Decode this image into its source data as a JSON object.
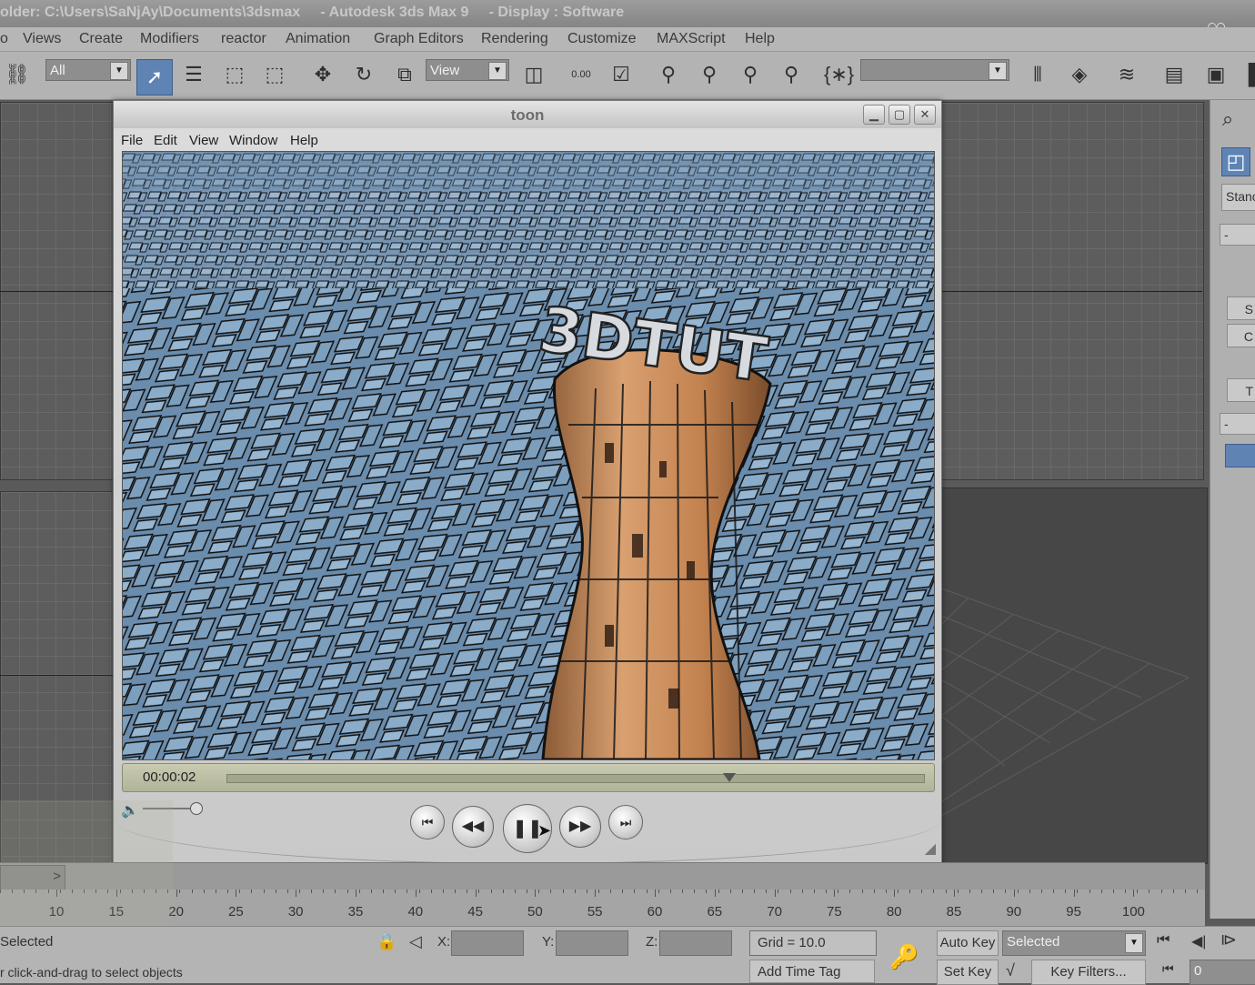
{
  "window": {
    "title": "older: C:\\Users\\SaNjAy\\Documents\\3dsmax     - Autodesk 3ds Max 9     - Display : Software"
  },
  "menu": [
    "o",
    "Views",
    "Create",
    "Modifiers",
    "reactor",
    "Animation",
    "Graph Editors",
    "Rendering",
    "Customize",
    "MAXScript",
    "Help"
  ],
  "toolbar": {
    "filter_value": "All",
    "refcoord_value": "View",
    "spinner_snap": "0.00",
    "selection_set_value": ""
  },
  "command_panel": {
    "dropdown_label": "Stanc",
    "rollout_minus": "-",
    "letters": [
      "S",
      "C",
      "T"
    ]
  },
  "toon_window": {
    "title": "toon",
    "menu": [
      "File",
      "Edit",
      "View",
      "Window",
      "Help"
    ],
    "render_text": "3DTUT",
    "timecode": "00:00:02",
    "playback_progress": 0.72
  },
  "timeline": {
    "ticks": [
      "10",
      "15",
      "20",
      "25",
      "30",
      "35",
      "40",
      "45",
      "50",
      "55",
      "60",
      "65",
      "70",
      "75",
      "80",
      "85",
      "90",
      "95",
      "100"
    ],
    "nav_arrow": ">"
  },
  "status": {
    "selection": "Selected",
    "prompt": "r click-and-drag to select objects",
    "x_label": "X:",
    "y_label": "Y:",
    "z_label": "Z:",
    "grid": "Grid = 10.0",
    "add_time_tag": "Add Time Tag",
    "auto_key": "Auto Key",
    "key_mode_value": "Selected",
    "set_key": "Set Key",
    "key_filters": "Key Filters...",
    "frame_value": "0"
  },
  "colors": {
    "render_sky": "#6c8fb0",
    "tower": "#c9875a",
    "accent": "#5f84b4"
  }
}
